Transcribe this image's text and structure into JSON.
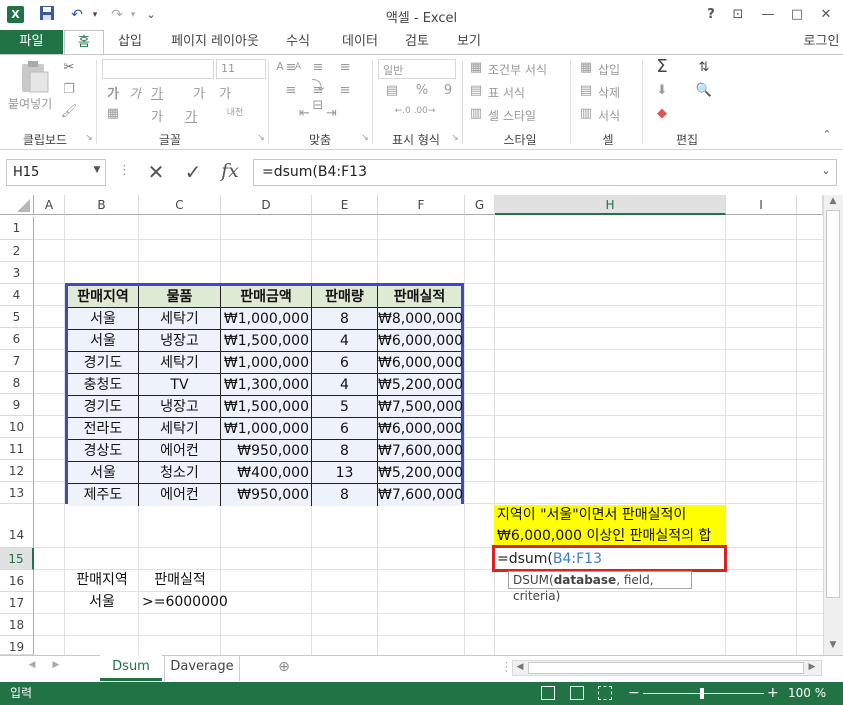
{
  "window": {
    "title": "액셀 - Excel",
    "login": "로그인",
    "help": "?",
    "restore_ribbon": "⊡",
    "minimize": "—",
    "maximize": "□",
    "close": "✕"
  },
  "qat": {
    "save": "💾",
    "undo": "↶",
    "redo": "↷",
    "more": "⌄"
  },
  "tabs": [
    "파일",
    "홈",
    "삽입",
    "페이지 레이아웃",
    "수식",
    "데이터",
    "검토",
    "보기"
  ],
  "active_tab": "홈",
  "ribbon": {
    "clipboard": {
      "label": "클립보드",
      "paste": "붙여넣기"
    },
    "font": {
      "label": "글꼴",
      "size": "11",
      "bold": "가",
      "italic": "가",
      "underline": "가",
      "grow": "가",
      "shrink": "가",
      "fill": "가",
      "color": "가",
      "phonetic": "내천"
    },
    "alignment": {
      "label": "맞춤"
    },
    "number": {
      "label": "표시 형식",
      "format": "일반",
      "percent": "%",
      "comma": "9"
    },
    "styles": {
      "label": "스타일",
      "conditional": "조건부 서식",
      "as_table": "표 서식",
      "cell_styles": "셀 스타일"
    },
    "cells": {
      "label": "셀",
      "insert": "삽입",
      "delete": "삭제",
      "format": "서식"
    },
    "editing": {
      "label": "편집",
      "sum": "Σ"
    }
  },
  "formula_bar": {
    "name_box": "H15",
    "cancel": "✕",
    "enter": "✓",
    "fx": "fx",
    "formula": "=dsum(B4:F13"
  },
  "columns": [
    "A",
    "B",
    "C",
    "D",
    "E",
    "F",
    "G",
    "H",
    "I"
  ],
  "selected_column": "H",
  "rows": [
    "1",
    "2",
    "3",
    "4",
    "5",
    "6",
    "7",
    "8",
    "9",
    "10",
    "11",
    "12",
    "13",
    "14",
    "15",
    "16",
    "17",
    "18",
    "19"
  ],
  "selected_row": "15",
  "table": {
    "headers": [
      "판매지역",
      "물품",
      "판매금액",
      "판매량",
      "판매실적"
    ],
    "rows": [
      [
        "서울",
        "세탁기",
        "₩1,000,000",
        "8",
        "₩8,000,000"
      ],
      [
        "서울",
        "냉장고",
        "₩1,500,000",
        "4",
        "₩6,000,000"
      ],
      [
        "경기도",
        "세탁기",
        "₩1,000,000",
        "6",
        "₩6,000,000"
      ],
      [
        "충청도",
        "TV",
        "₩1,300,000",
        "4",
        "₩5,200,000"
      ],
      [
        "경기도",
        "냉장고",
        "₩1,500,000",
        "5",
        "₩7,500,000"
      ],
      [
        "전라도",
        "세탁기",
        "₩1,000,000",
        "6",
        "₩6,000,000"
      ],
      [
        "경상도",
        "에어컨",
        "₩950,000",
        "8",
        "₩7,600,000"
      ],
      [
        "서울",
        "청소기",
        "₩400,000",
        "13",
        "₩5,200,000"
      ],
      [
        "제주도",
        "에어컨",
        "₩950,000",
        "8",
        "₩7,600,000"
      ]
    ]
  },
  "criteria": {
    "header1": "판매지역",
    "header2": "판매실적",
    "value1": "서울",
    "value2": ">=6000000"
  },
  "note": {
    "line1": "지역이 \"서울\"이면서 판매실적이",
    "line2": "₩6,000,000 이상인 판매실적의 합"
  },
  "editing_cell": {
    "prefix": "=dsum(",
    "ref": "B4:F13"
  },
  "tooltip": {
    "func": "DSUM(",
    "bold_arg": "database",
    "rest": ", field, criteria)"
  },
  "sheets": [
    "Dsum",
    "Daverage"
  ],
  "active_sheet": "Dsum",
  "status": {
    "mode": "입력",
    "zoom": "100 %"
  },
  "colors": {
    "excel_green": "#217346",
    "table_border": "#3d4bbf",
    "note_fill": "#ffff00",
    "edit_border": "#dd2222"
  }
}
